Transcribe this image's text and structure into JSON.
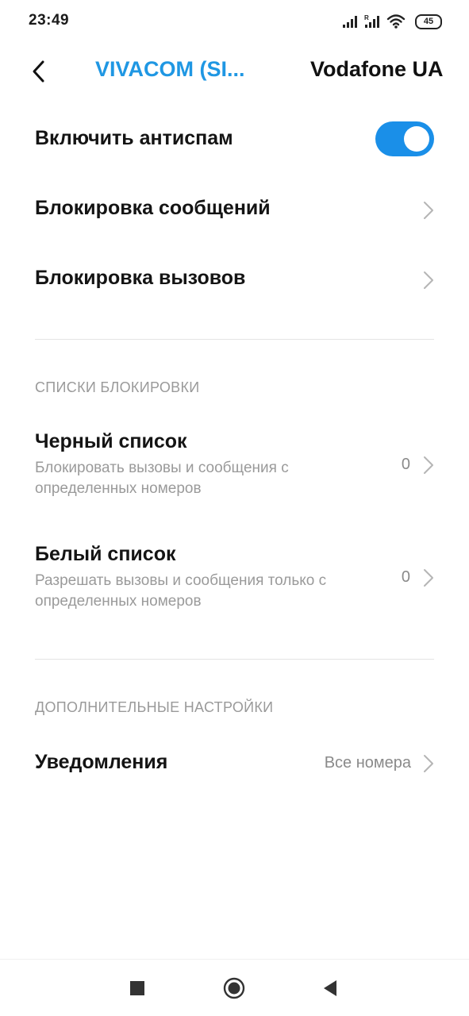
{
  "status_bar": {
    "time": "23:49",
    "battery": "45",
    "icons": [
      "cellular-signal-icon",
      "cellular-signal-roaming-icon",
      "wifi-icon",
      "battery-icon"
    ]
  },
  "header": {
    "back_icon": "back-arrow-icon",
    "tabs": [
      {
        "label": "VIVACOM (SI...",
        "active": true
      },
      {
        "label": "Vodafone UA",
        "active": false
      }
    ],
    "active_color": "#1f97e3"
  },
  "settings": {
    "antispam": {
      "label": "Включить антиспам",
      "enabled": true,
      "toggle_color": "#1a8fe8"
    },
    "message_block": {
      "label": "Блокировка сообщений"
    },
    "call_block": {
      "label": "Блокировка вызовов"
    }
  },
  "block_lists": {
    "section_title": "СПИСКИ БЛОКИРОВКИ",
    "blacklist": {
      "title": "Черный список",
      "subtitle": "Блокировать вызовы и сообщения с определенных номеров",
      "count": "0"
    },
    "whitelist": {
      "title": "Белый список",
      "subtitle": "Разрешать вызовы и сообщения только с определенных номеров",
      "count": "0"
    }
  },
  "additional": {
    "section_title": "ДОПОЛНИТЕЛЬНЫЕ НАСТРОЙКИ",
    "notifications": {
      "label": "Уведомления",
      "value": "Все номера"
    }
  },
  "nav_bar": {
    "icons": [
      "recents-square-icon",
      "home-circle-icon",
      "back-triangle-icon"
    ]
  }
}
